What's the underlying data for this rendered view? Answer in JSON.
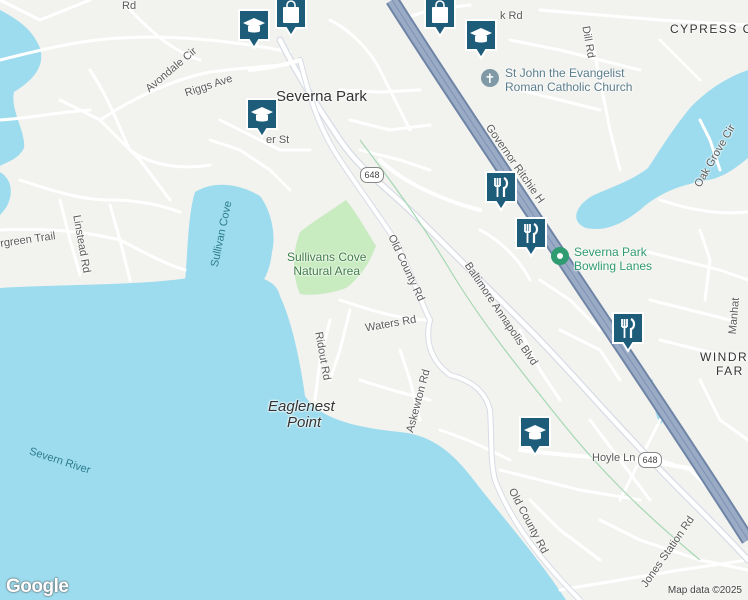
{
  "map": {
    "place_labels": {
      "severna_park": "Severna Park",
      "cypress_creek": "CYPRESS C",
      "windridge": "WINDR",
      "windridge2": "FAR",
      "eaglenest": "Eaglenest",
      "eaglenest2": "Point"
    },
    "water_labels": {
      "severn_river": "Severn River",
      "sullivan_cove": "Sullivan Cove"
    },
    "park_label": {
      "line1": "Sullivans Cove",
      "line2": "Natural Area"
    },
    "poi_labels": {
      "church_line1": "St John the Evangelist",
      "church_line2": "Roman Catholic Church",
      "bowling_line1": "Severna Park",
      "bowling_line2": "Bowling Lanes"
    },
    "road_labels": {
      "avondale": "Avondale Cir",
      "riggs": "Riggs Ave",
      "ritchie": "Governor Ritchie H",
      "old_county_1": "Old County Rd",
      "old_county_2": "Old County Rd",
      "baltimore": "Baltimore Annapolis Blvd",
      "waters": "Waters Rd",
      "ridout": "Ridout Rd",
      "askewton": "Askewton Rd",
      "hoyle": "Hoyle Ln",
      "jones": "Jones Station Rd",
      "linstead": "Linstead Rd",
      "evergreen": "rgreen Trail",
      "dill": "Dill Rd",
      "oak_grove": "Oak Grove Cir",
      "manhattan": "Manhat",
      "top_rd": "Rd",
      "top_rd2": "k Rd",
      "er_st": "er St"
    },
    "shields": {
      "s1": "648",
      "s2": "648"
    },
    "attribution": "Map data ©2025",
    "logo": "Google"
  },
  "markers": [
    {
      "type": "school",
      "icon": "graduation-cap-icon"
    },
    {
      "type": "shopping",
      "icon": "shopping-bag-icon"
    },
    {
      "type": "shopping",
      "icon": "shopping-bag-icon"
    },
    {
      "type": "school",
      "icon": "graduation-cap-icon"
    },
    {
      "type": "school",
      "icon": "graduation-cap-icon"
    },
    {
      "type": "restaurant",
      "icon": "fork-knife-icon"
    },
    {
      "type": "restaurant",
      "icon": "fork-knife-icon"
    },
    {
      "type": "restaurant",
      "icon": "fork-knife-icon"
    },
    {
      "type": "school",
      "icon": "graduation-cap-icon"
    }
  ],
  "colors": {
    "water": "#9ddcee",
    "land": "#f2f2ef",
    "park": "#c8ebc0",
    "highway": "#8a9bb5",
    "road": "#ffffff",
    "marker": "#1e5d7a"
  }
}
